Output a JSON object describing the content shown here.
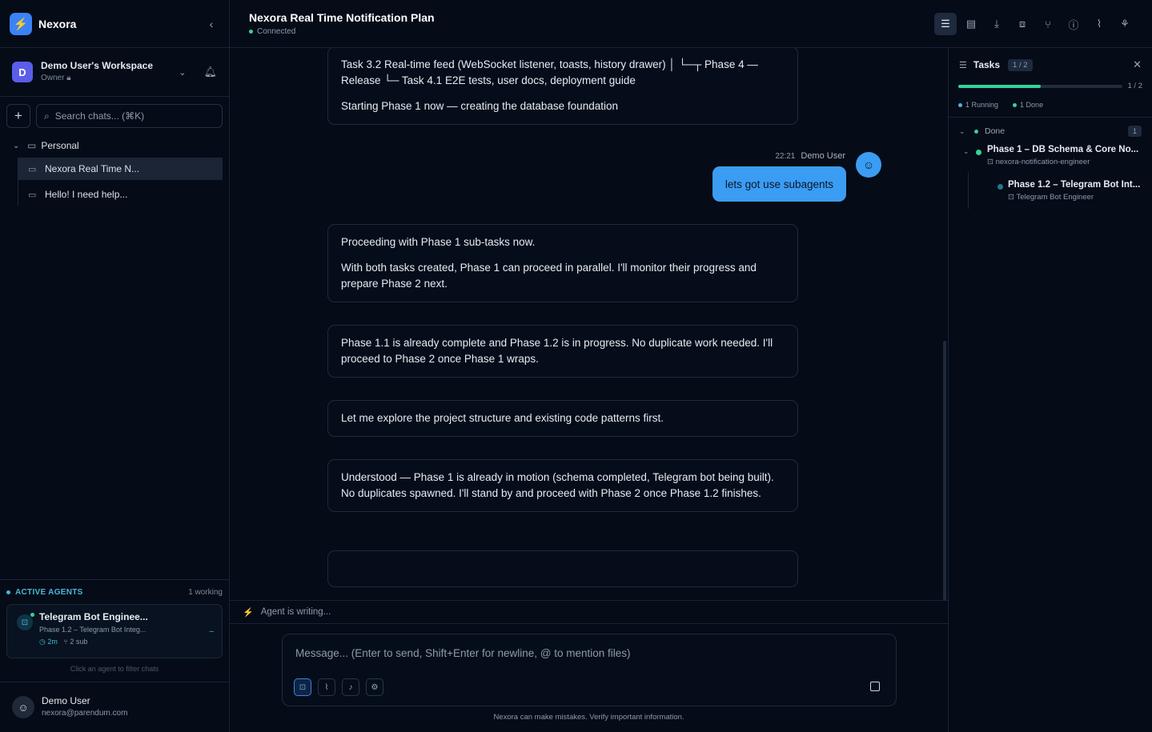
{
  "app": {
    "name": "Nexora"
  },
  "workspace": {
    "initial": "D",
    "name": "Demo User's Workspace",
    "role": "Owner"
  },
  "search": {
    "placeholder": "Search chats... (⌘K)"
  },
  "folder": {
    "name": "Personal"
  },
  "chats": [
    {
      "title": "Nexora Real Time N..."
    },
    {
      "title": "Hello! I need help..."
    }
  ],
  "agents": {
    "title": "ACTIVE AGENTS",
    "count": "1 working",
    "card": {
      "name": "Telegram Bot Enginee...",
      "task": "Phase 1.2 – Telegram Bot Integ...",
      "time": "2m",
      "subs": "2 sub"
    },
    "hint": "Click an agent to filter chats"
  },
  "user": {
    "name": "Demo User",
    "email": "nexora@parendum.com"
  },
  "topbar": {
    "title": "Nexora Real Time Notification Plan",
    "status": "Connected"
  },
  "messages": {
    "m1_p1": "Task 3.2 Real-time feed (WebSocket listener, toasts, history drawer) │ └─┬ Phase 4 — Release └─ Task 4.1 E2E tests, user docs, deployment guide",
    "m1_p2": "Starting Phase 1 now — creating the database foundation",
    "user_time": "22:21",
    "user_name": "Demo User",
    "user_text": "lets got use subagents",
    "m2_p1": "Proceeding with Phase 1 sub-tasks now.",
    "m2_p2": "With both tasks created, Phase 1 can proceed in parallel. I'll monitor their progress and prepare Phase 2 next.",
    "m3": "Phase 1.1 is already complete and Phase 1.2 is in progress. No duplicate work needed. I'll proceed to Phase 2 once Phase 1 wraps.",
    "m4": "Let me explore the project structure and existing code patterns first.",
    "m5": "Understood — Phase 1 is already in motion (schema completed, Telegram bot being built). No duplicates spawned. I'll stand by and proceed with Phase 2 once Phase 1.2 finishes."
  },
  "writing": "Agent is writing...",
  "composer": {
    "placeholder": "Message... (Enter to send, Shift+Enter for newline, @ to mention files)"
  },
  "disclaimer": "Nexora can make mistakes. Verify important information.",
  "tasks": {
    "title": "Tasks",
    "badge": "1 / 2",
    "fraction": "1 / 2",
    "progress": 0.5,
    "running": "1 Running",
    "done": "1 Done",
    "group": {
      "label": "Done",
      "count": "1"
    },
    "items": [
      {
        "name": "Phase 1 – DB Schema & Core No...",
        "agent": "nexora-notification-engineer"
      },
      {
        "name": "Phase 1.2 – Telegram Bot Int...",
        "agent": "Telegram Bot Engineer"
      }
    ]
  },
  "colors": {
    "accent": "#3b9cf3",
    "success": "#34d399",
    "agent": "#4ab6d8",
    "background": "#050b17"
  }
}
